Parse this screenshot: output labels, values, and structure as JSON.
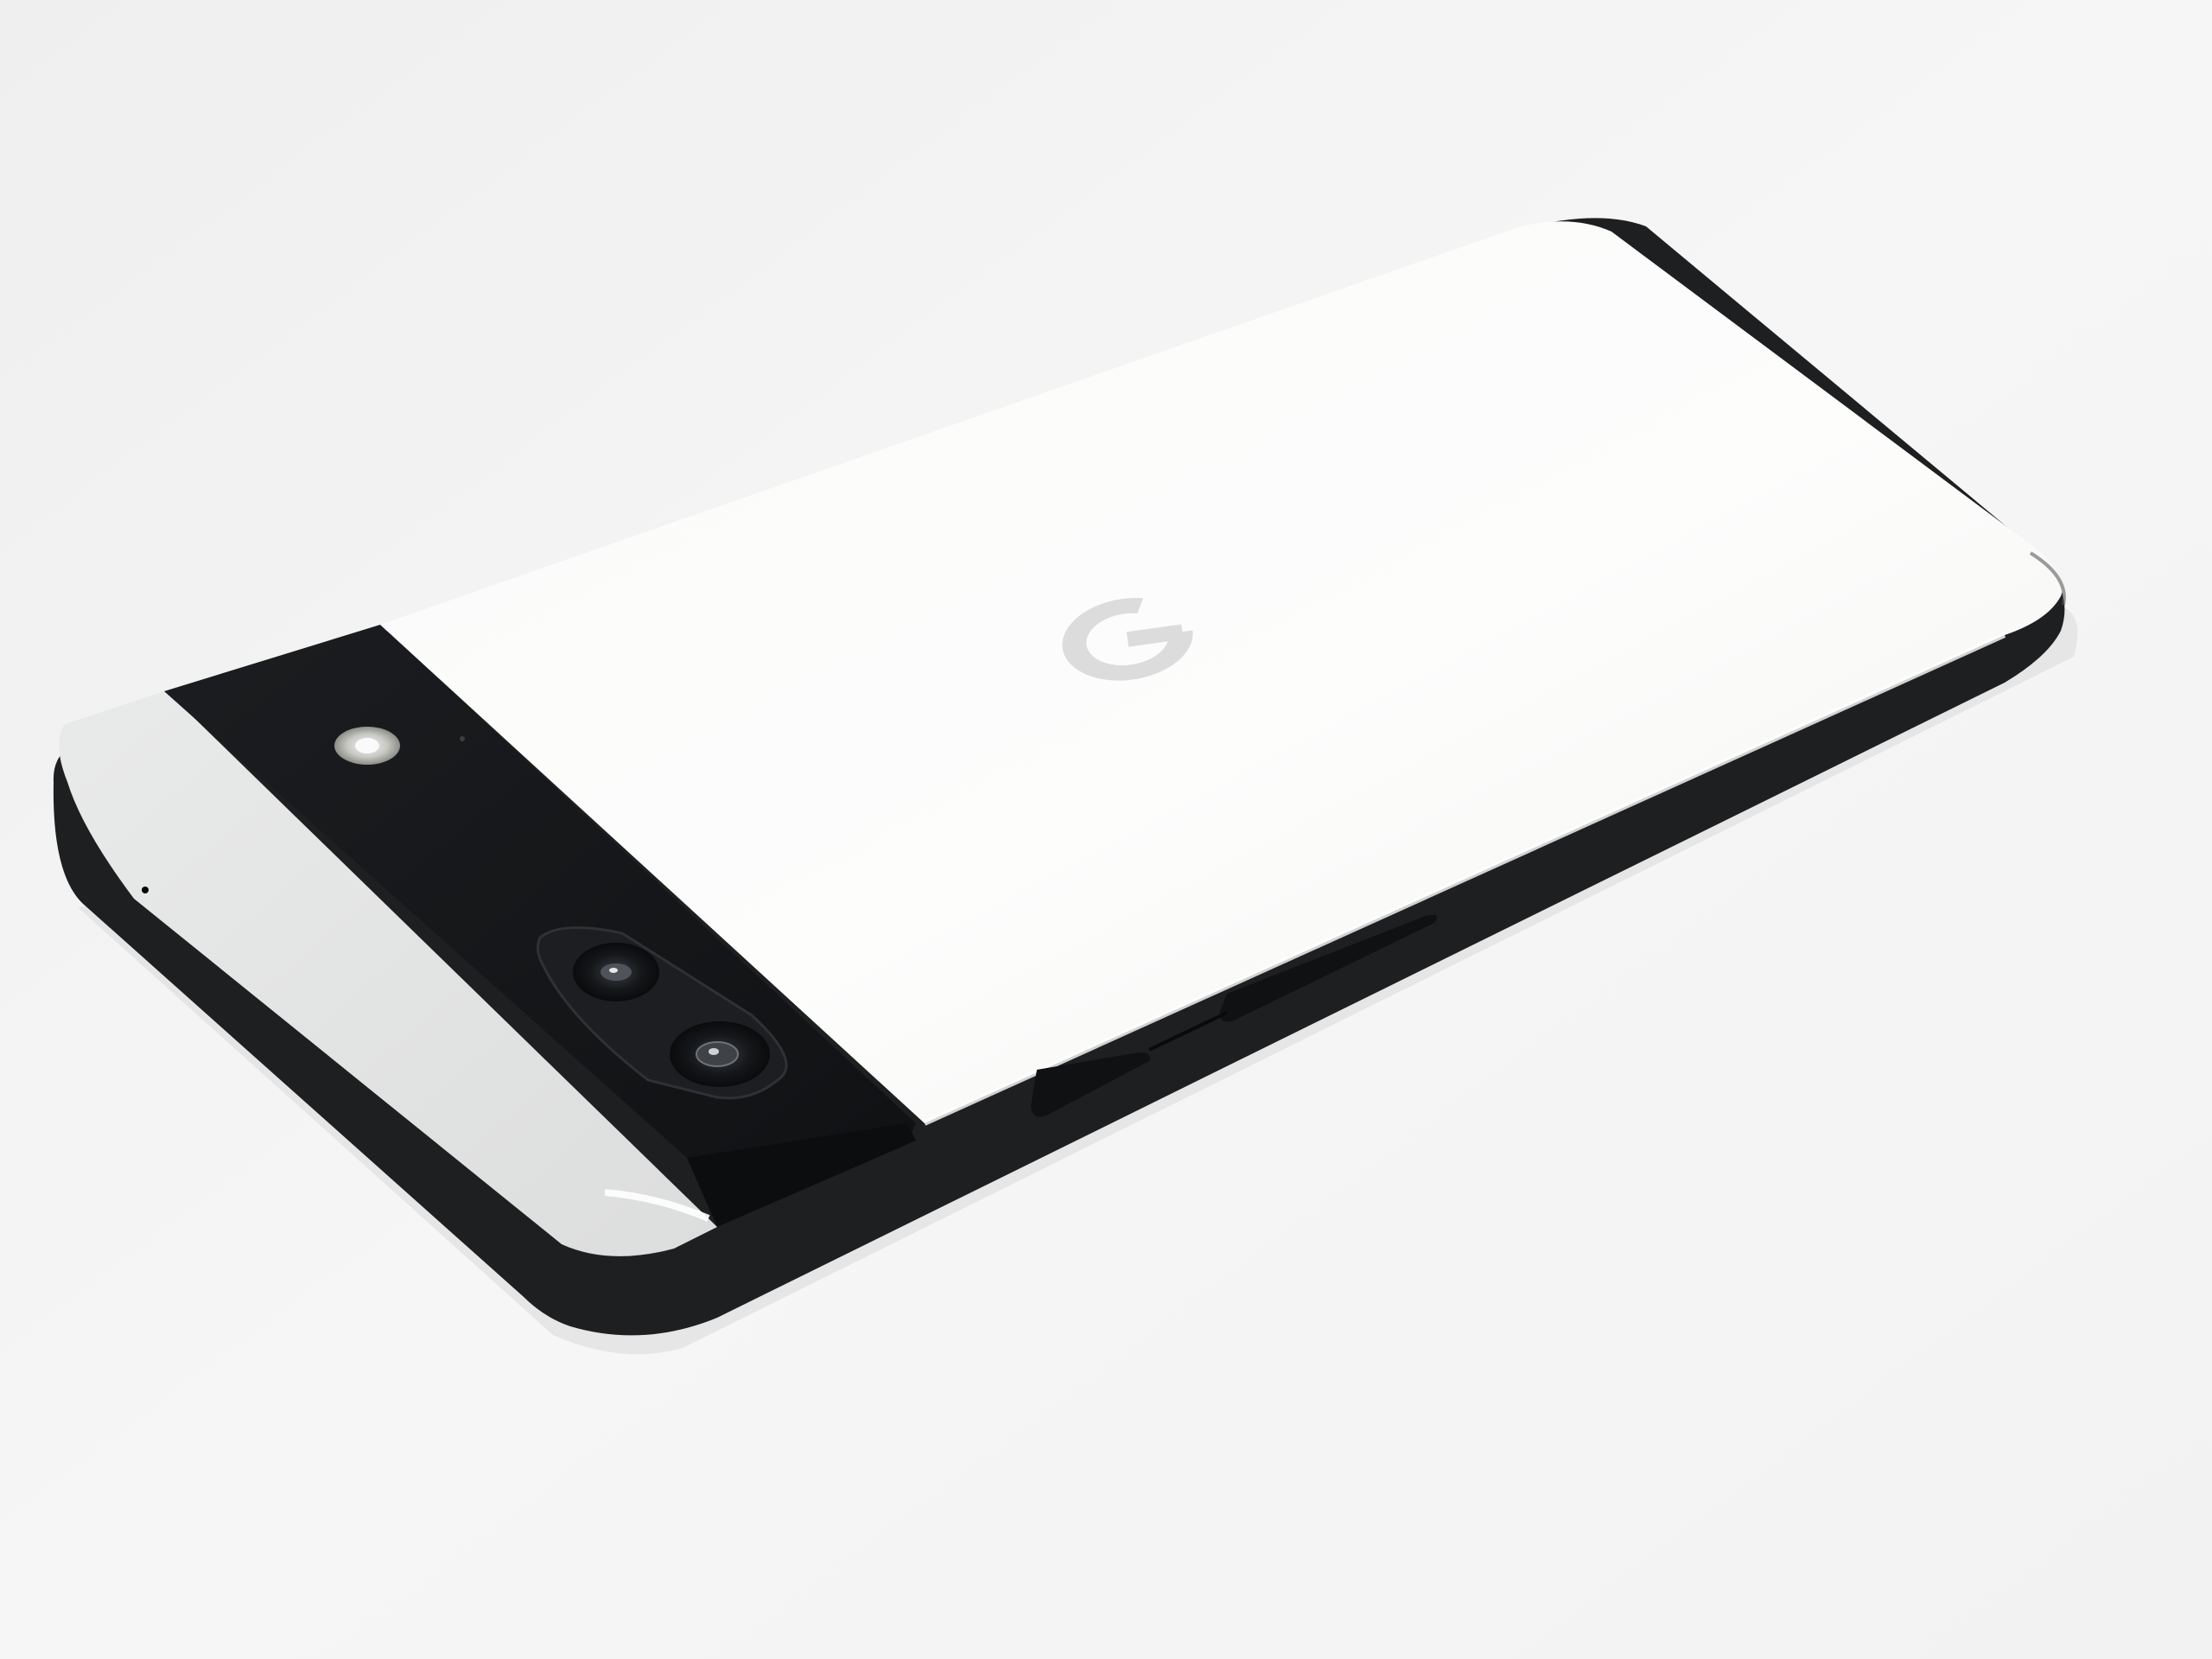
{
  "scene": {
    "subject": "smartphone-rear",
    "background_color": "#f4f4f4",
    "frame_color": "#1e1f20",
    "back_panel_color": "#fbfbfa",
    "tip_panel_color": "#e4e5e5",
    "camera_bar_color": "#16181b",
    "logo_color": "#dcdcdc",
    "logo_icon": "g-logo-icon"
  }
}
